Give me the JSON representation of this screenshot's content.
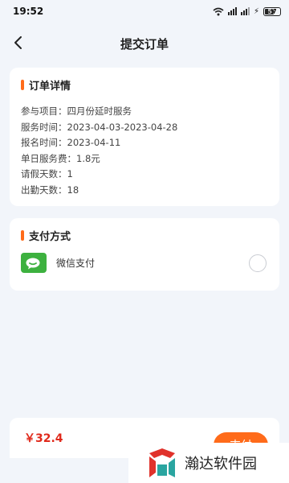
{
  "status_bar": {
    "time": "19:52",
    "battery": "57",
    "battery_level": 0.57
  },
  "nav": {
    "title": "提交订单"
  },
  "order": {
    "title": "订单详情",
    "rows": [
      "参与项目：四月份延时服务",
      "服务时间：2023-04-03-2023-04-28",
      "报名时间：2023-04-11",
      "单日服务费：1.8元",
      "请假天数：1",
      "出勤天数：18"
    ]
  },
  "payment": {
    "title": "支付方式",
    "method_label": "微信支付",
    "selected": false
  },
  "footer": {
    "price": "￥32.4",
    "pay_label": "支付"
  },
  "watermark": {
    "text": "瀚达软件园"
  },
  "colors": {
    "accent": "#ff6b1a",
    "price": "#e02a1c",
    "wechat": "#3db13f",
    "background": "#f2f5fa"
  },
  "icons": {
    "back": "chevron-left-icon",
    "wechat": "wechat-icon",
    "wifi": "wifi-icon",
    "signal": "signal-icon",
    "battery": "battery-icon"
  }
}
